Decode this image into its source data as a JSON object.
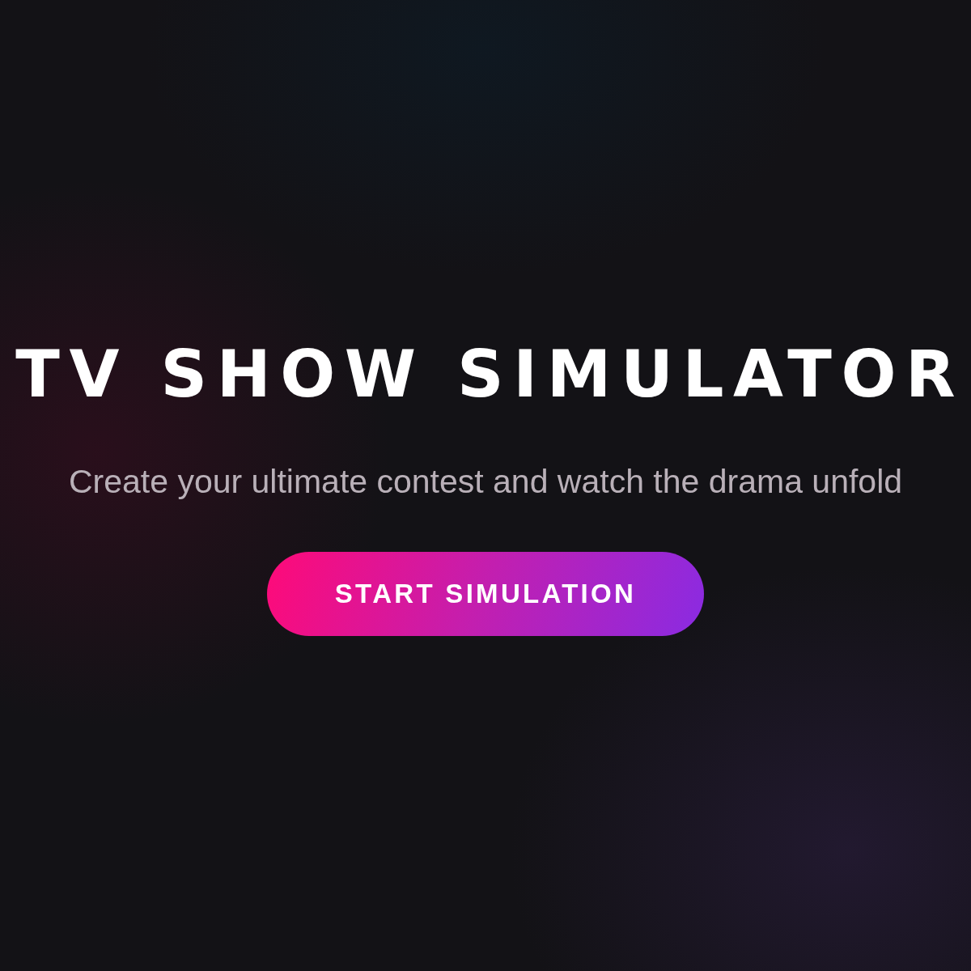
{
  "hero": {
    "title": "TV SHOW SIMULATOR",
    "subtitle": "Create your ultimate contest and watch the drama unfold",
    "button": {
      "label": "START SIMULATION"
    }
  }
}
